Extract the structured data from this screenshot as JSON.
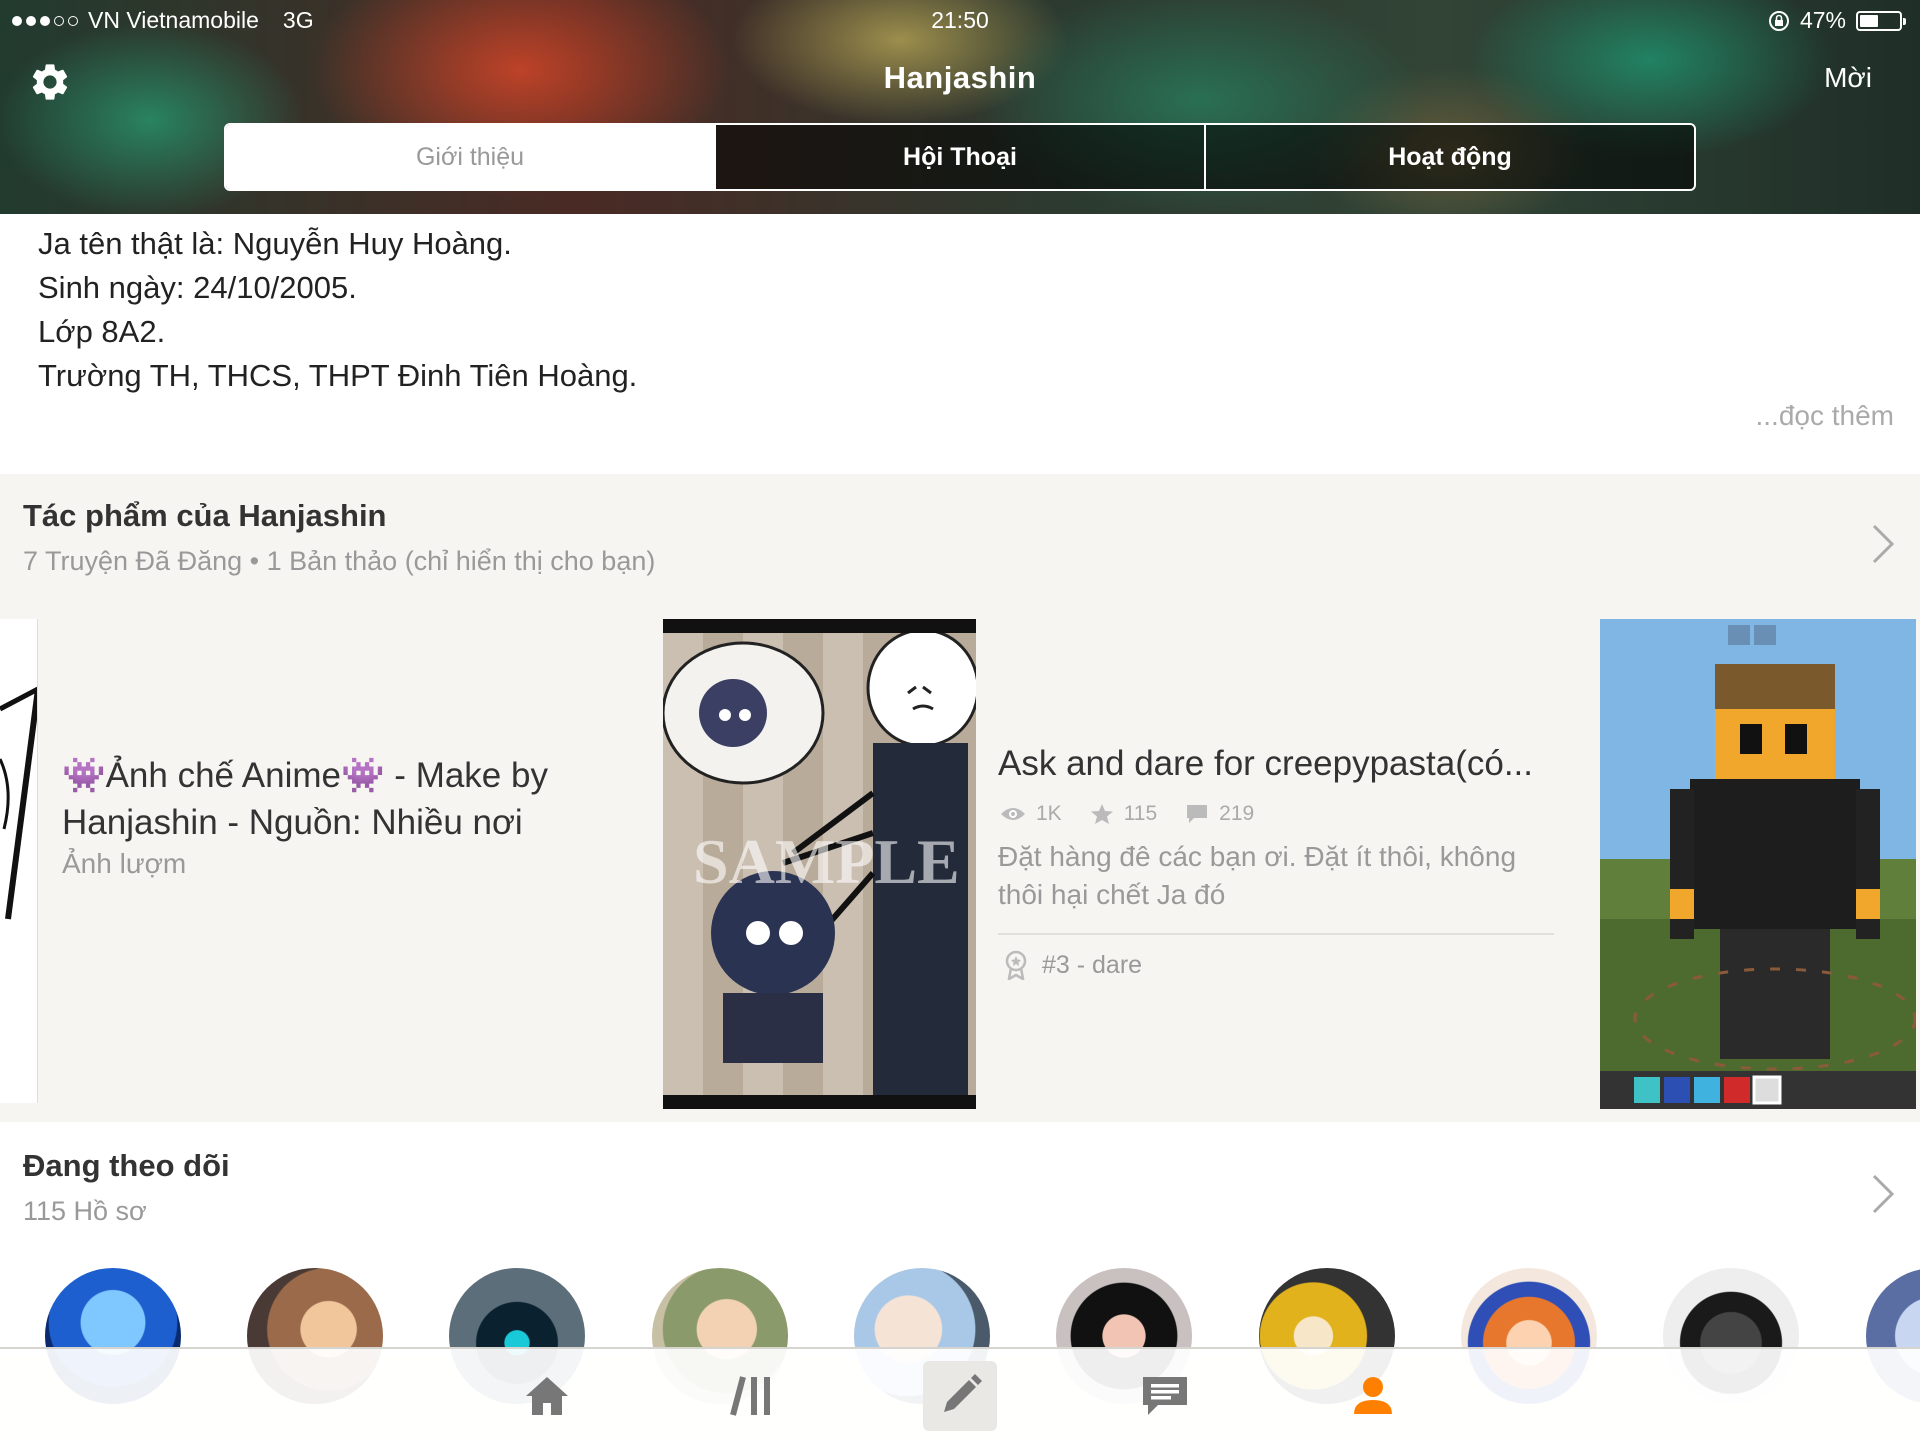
{
  "status_bar": {
    "carrier": "VN Vietnamobile",
    "network": "3G",
    "time": "21:50",
    "battery": "47%",
    "battery_level": 0.47
  },
  "header": {
    "title": "Hanjashin",
    "invite_label": "Mời",
    "settings_icon": "gear-icon",
    "tabs": [
      {
        "label": "Giới thiệu",
        "active": true
      },
      {
        "label": "Hội Thoại",
        "active": false
      },
      {
        "label": "Hoạt động",
        "active": false
      }
    ]
  },
  "about": {
    "lines": [
      "Ja tên thật là: Nguyễn Huy Hoàng.",
      "Sinh ngày: 24/10/2005.",
      "Lớp 8A2.",
      "Trường TH, THCS, THPT Đinh Tiên Hoàng."
    ],
    "read_more": "...đọc thêm"
  },
  "works": {
    "title": "Tác phẩm của Hanjashin",
    "subtitle": "7 Truyện Đã Đăng • 1 Bản thảo (chỉ hiển thị cho bạn)",
    "stories": [
      {
        "title": "👾Ảnh chế Anime👾 - Make by Hanjashin - Nguồn: Nhiều nơi",
        "category": "Ảnh lượm"
      },
      {
        "title": "Ask and dare for creepypasta(có...",
        "views": "1K",
        "votes": "115",
        "comments": "219",
        "description": "Đặt hàng đê các bạn ơi. Đặt ít thôi, không thôi hại chết Ja đó",
        "rank": "#3 - dare"
      }
    ]
  },
  "following": {
    "title": "Đang theo dõi",
    "subtitle": "115 Hồ sơ"
  },
  "colors": {
    "accent": "#ff8000",
    "tab_active_text": "#999999",
    "muted_text": "#999999"
  },
  "bottom_nav": [
    {
      "icon": "home-icon"
    },
    {
      "icon": "library-icon"
    },
    {
      "icon": "pencil-icon"
    },
    {
      "icon": "messages-icon"
    },
    {
      "icon": "profile-icon",
      "active": true
    }
  ]
}
